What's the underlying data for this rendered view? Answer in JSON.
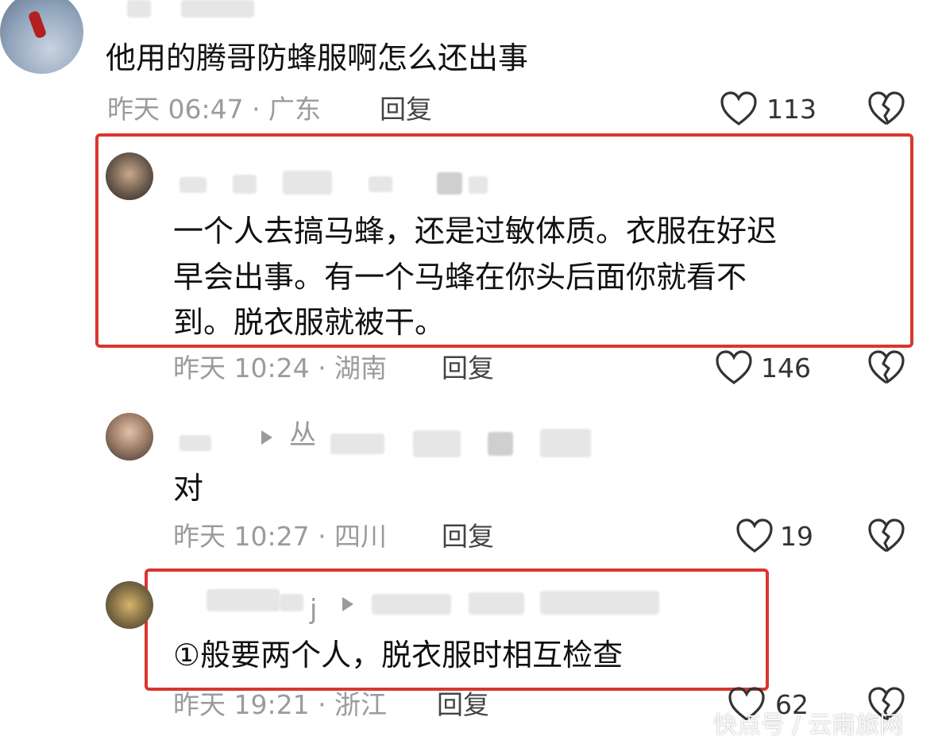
{
  "comments": [
    {
      "text": "他用的腾哥防蜂服啊怎么还出事",
      "time": "昨天 06:47 · 广东",
      "reply_label": "回复",
      "likes": "113"
    },
    {
      "text_lines": [
        "一个人去搞马蜂，还是过敏体质。衣服在好迟",
        "早会出事。有一个马蜂在你头后面你就看不",
        "到。脱衣服就被干。"
      ],
      "time": "昨天 10:24 · 湖南",
      "reply_label": "回复",
      "likes": "146"
    },
    {
      "name_partial": "丛",
      "text": "对",
      "time": "昨天 10:27 · 四川",
      "reply_label": "回复",
      "likes": "19"
    },
    {
      "name_partial": "j",
      "text": "①般要两个人，脱衣服时相互检查",
      "time": "昨天 19:21 · 浙江",
      "reply_label": "回复",
      "likes": "62"
    }
  ],
  "watermark": "快点号 / 云南旅网",
  "colors": {
    "highlight": "#d9362e",
    "meta": "#9b9b9b"
  },
  "icons": [
    "heart-outline-icon",
    "broken-heart-icon",
    "reply-arrow-icon"
  ]
}
